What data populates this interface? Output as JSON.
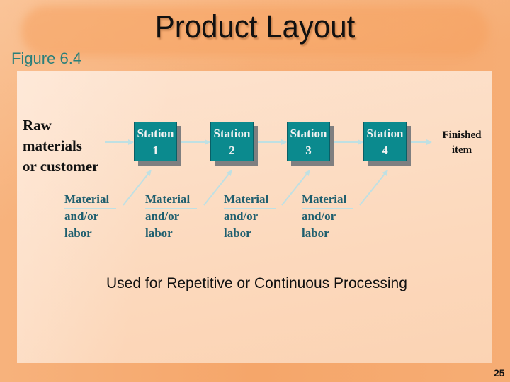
{
  "slide": {
    "title": "Product Layout",
    "figure_label": "Figure 6.4",
    "subtitle": "Used for Repetitive or Continuous Processing",
    "page_number": "25"
  },
  "diagram": {
    "source": [
      "Raw",
      "materials",
      "or customer"
    ],
    "stations": [
      {
        "line1": "Station",
        "line2": "1"
      },
      {
        "line1": "Station",
        "line2": "2"
      },
      {
        "line1": "Station",
        "line2": "3"
      },
      {
        "line1": "Station",
        "line2": "4"
      }
    ],
    "output": [
      "Finished",
      "item"
    ],
    "inputs": [
      {
        "line1": "Material",
        "line2": "and/or",
        "line3": "labor"
      },
      {
        "line1": "Material",
        "line2": "and/or",
        "line3": "labor"
      },
      {
        "line1": "Material",
        "line2": "and/or",
        "line3": "labor"
      },
      {
        "line1": "Material",
        "line2": "and/or",
        "line3": "labor"
      }
    ]
  },
  "colors": {
    "station_fill": "#0b8a8e",
    "station_text": "#f2f2f2",
    "arrow": "#bfe0e3",
    "input_text": "#1f5f6f",
    "figure_label": "#2a7f7a"
  }
}
